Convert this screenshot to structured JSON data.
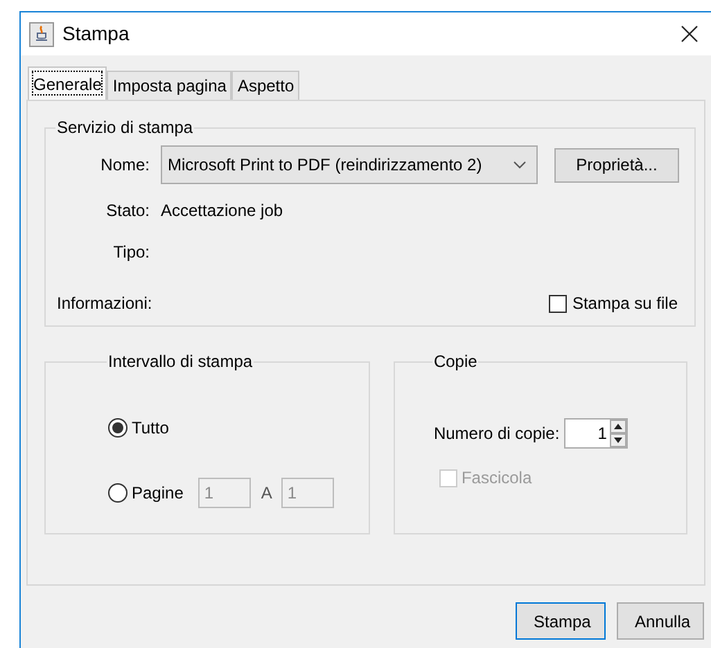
{
  "window": {
    "title": "Stampa"
  },
  "tabs": [
    {
      "label": "Generale",
      "selected": true
    },
    {
      "label": "Imposta pagina",
      "selected": false
    },
    {
      "label": "Aspetto",
      "selected": false
    }
  ],
  "print_service": {
    "title": "Servizio di stampa",
    "name_label": "Nome:",
    "printer": "Microsoft Print to PDF (reindirizzamento 2)",
    "properties_button": "Proprietà...",
    "status_label": "Stato:",
    "status": "Accettazione job",
    "type_label": "Tipo:",
    "info_label": "Informazioni:",
    "print_to_file": {
      "label": "Stampa su file",
      "checked": false
    }
  },
  "print_range": {
    "title": "Intervallo di stampa",
    "options": [
      {
        "label": "Tutto",
        "selected": true
      },
      {
        "label": "Pagine",
        "selected": false
      }
    ],
    "from": {
      "value": "1",
      "disabled": true
    },
    "to_label": "A",
    "to": {
      "value": "1",
      "disabled": true
    }
  },
  "copies": {
    "title": "Copie",
    "count_label": "Numero di copie:",
    "count": "1",
    "collate": {
      "label": "Fascicola",
      "checked": false,
      "disabled": true
    }
  },
  "buttons": [
    {
      "label": "Stampa",
      "default": true
    },
    {
      "label": "Annulla",
      "default": false
    }
  ]
}
